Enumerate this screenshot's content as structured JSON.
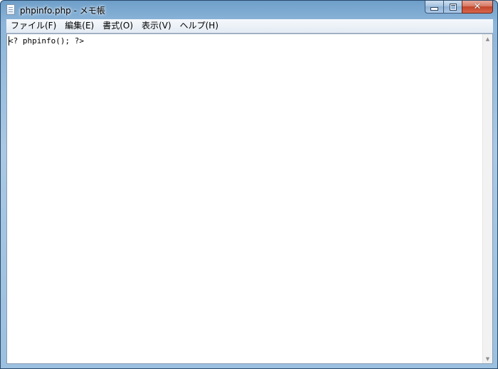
{
  "window": {
    "title": "phpinfo.php - メモ帳",
    "minimize_glyph": "",
    "maximize_glyph": "",
    "close_glyph": "✕"
  },
  "menu": {
    "items": [
      {
        "label": "ファイル(F)"
      },
      {
        "label": "編集(E)"
      },
      {
        "label": "書式(O)"
      },
      {
        "label": "表示(V)"
      },
      {
        "label": "ヘルプ(H)"
      }
    ]
  },
  "editor": {
    "content": "<? phpinfo(); ?>"
  },
  "scrollbar": {
    "up_arrow": "▲",
    "down_arrow": "▼"
  }
}
